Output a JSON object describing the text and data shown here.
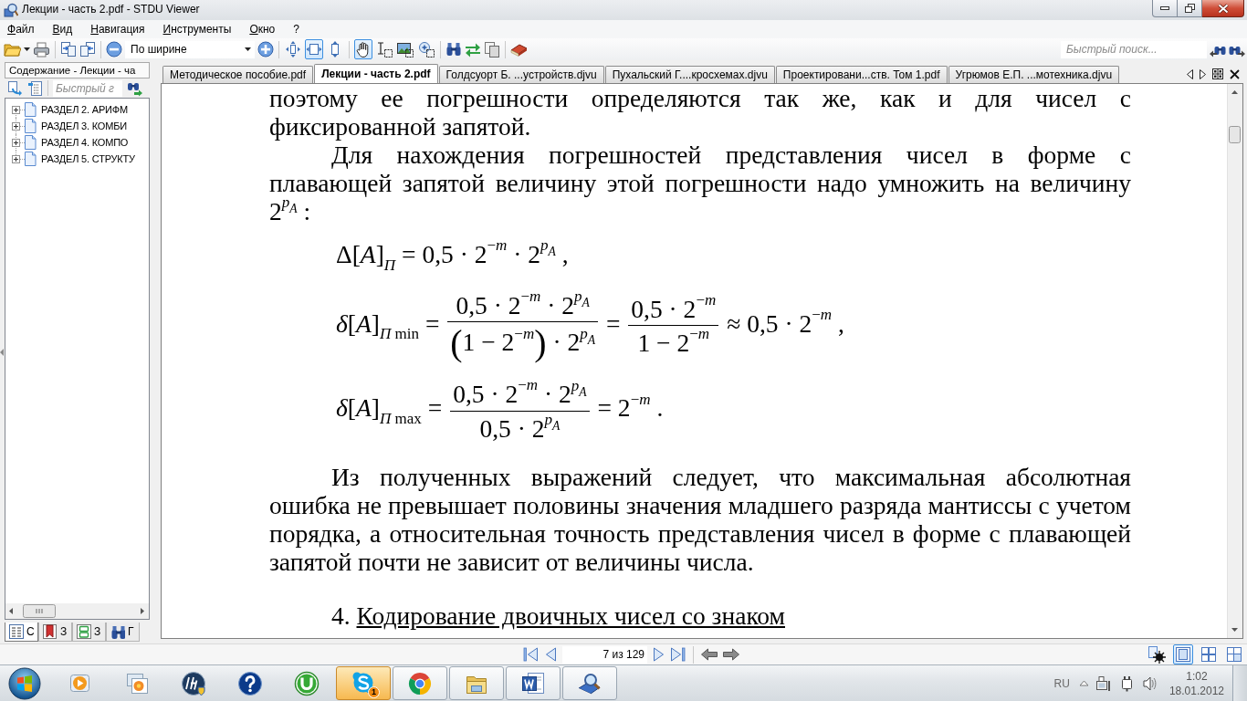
{
  "window": {
    "title": "Лекции - часть 2.pdf - STDU Viewer"
  },
  "menu": [
    "Файл",
    "Вид",
    "Навигация",
    "Инструменты",
    "Окно",
    "?"
  ],
  "toolbar": {
    "zoom_mode": "По ширине",
    "fit_buttons": [
      {
        "selected": false
      },
      {
        "selected": true
      },
      {
        "selected": false
      }
    ],
    "tool_buttons": [
      {
        "selected": true
      },
      {
        "selected": false
      },
      {
        "selected": false
      },
      {
        "selected": false
      }
    ],
    "quick_search": {
      "placeholder": "Быстрый поиск..."
    }
  },
  "sidebar": {
    "title": "Содержание - Лекции - ча",
    "search": {
      "placeholder": "Быстрый г"
    },
    "tree": [
      {
        "label": "РАЗДЕЛ 2. АРИФМ",
        "expanded": false
      },
      {
        "label": "РАЗДЕЛ 3. КОМБИ",
        "expanded": false
      },
      {
        "label": "РАЗДЕЛ 4. КОМПО",
        "expanded": false
      },
      {
        "label": "РАЗДЕЛ 5. СТРУКТУ",
        "expanded": false
      }
    ],
    "tabs": [
      {
        "label": "С",
        "selected": true
      },
      {
        "label": "З",
        "selected": false
      },
      {
        "label": "З",
        "selected": false
      },
      {
        "label": "Г",
        "selected": false
      }
    ]
  },
  "document_tabs": [
    {
      "label": "Методическое пособие.pdf",
      "selected": false
    },
    {
      "label": "Лекции - часть 2.pdf",
      "selected": true
    },
    {
      "label": "Голдсуорт Б. ...устройств.djvu",
      "selected": false
    },
    {
      "label": "Пухальский Г....кросхемах.djvu",
      "selected": false
    },
    {
      "label": "Проектировани...ств. Том 1.pdf",
      "selected": false
    },
    {
      "label": "Угрюмов Е.П. ...мотехника.djvu",
      "selected": false
    }
  ],
  "document": {
    "blocks": [
      {
        "kind": "paragraph",
        "indent": false,
        "text": "поэтому ее погрешности определяются так же, как и для чисел с фиксированной запятой."
      },
      {
        "kind": "paragraph",
        "indent": true,
        "text": "Для нахождения погрешностей представления чисел в форме с плавающей запятой величину этой погрешности надо умножить на величину",
        "math": [
          {
            "kind": "text",
            "text": "2"
          },
          {
            "kind": "sup",
            "text": "*p*",
            "sub": "*A*"
          },
          {
            "kind": "text",
            "text": " :"
          }
        ]
      },
      {
        "kind": "formula",
        "parts": [
          {
            "kind": "text",
            "text": "Δ[*A*]"
          },
          {
            "kind": "sub",
            "text": "*П*"
          },
          {
            "kind": "text",
            "text": " = 0,5 · 2"
          },
          {
            "kind": "sup",
            "text": "−*m*"
          },
          {
            "kind": "text",
            "text": " · 2"
          },
          {
            "kind": "sup",
            "text": "*p*",
            "sub": "*A*"
          },
          {
            "kind": "text",
            "text": " ,"
          }
        ]
      },
      {
        "kind": "formula",
        "parts": [
          {
            "kind": "text",
            "text": "*δ*[*A*]"
          },
          {
            "kind": "sub",
            "text": "*П* min"
          },
          {
            "kind": "text",
            "text": " = "
          },
          {
            "kind": "frac",
            "num": [
              {
                "kind": "text",
                "text": "0,5 · 2"
              },
              {
                "kind": "sup",
                "text": "−*m*"
              },
              {
                "kind": "text",
                "text": " · 2"
              },
              {
                "kind": "sup",
                "text": "*p*",
                "sub": "*A*"
              }
            ],
            "den": [
              {
                "kind": "big",
                "text": "("
              },
              {
                "kind": "text",
                "text": "1 − 2"
              },
              {
                "kind": "sup",
                "text": "−*m*"
              },
              {
                "kind": "big",
                "text": ")"
              },
              {
                "kind": "text",
                "text": " · 2"
              },
              {
                "kind": "sup",
                "text": "*p*",
                "sub": "*A*"
              }
            ]
          },
          {
            "kind": "text",
            "text": " = "
          },
          {
            "kind": "frac",
            "num": [
              {
                "kind": "text",
                "text": "0,5 · 2"
              },
              {
                "kind": "sup",
                "text": "−*m*"
              }
            ],
            "den": [
              {
                "kind": "text",
                "text": "1 − 2"
              },
              {
                "kind": "sup",
                "text": "−*m*"
              }
            ]
          },
          {
            "kind": "text",
            "text": " ≈ 0,5 · 2"
          },
          {
            "kind": "sup",
            "text": "−*m*"
          },
          {
            "kind": "text",
            "text": " ,"
          }
        ]
      },
      {
        "kind": "formula",
        "parts": [
          {
            "kind": "text",
            "text": "*δ*[*A*]"
          },
          {
            "kind": "sub",
            "text": "*П* max"
          },
          {
            "kind": "text",
            "text": " = "
          },
          {
            "kind": "frac",
            "num": [
              {
                "kind": "text",
                "text": "0,5 · 2"
              },
              {
                "kind": "sup",
                "text": "−*m*"
              },
              {
                "kind": "text",
                "text": " · 2"
              },
              {
                "kind": "sup",
                "text": "*p*",
                "sub": "*A*"
              }
            ],
            "den": [
              {
                "kind": "text",
                "text": "0,5 · 2"
              },
              {
                "kind": "sup",
                "text": "*p*",
                "sub": "*A*"
              }
            ]
          },
          {
            "kind": "text",
            "text": " = 2"
          },
          {
            "kind": "sup",
            "text": "−*m*"
          },
          {
            "kind": "text",
            "text": " ."
          }
        ]
      },
      {
        "kind": "paragraph",
        "indent": true,
        "text": "Из полученных выражений следует, что максимальная абсолютная ошибка не превышает половины значения младшего разряда мантиссы с учетом порядка, а относительная точность представления чисел в форме с плавающей запятой почти не зависит от величины числа."
      },
      {
        "kind": "heading",
        "number": "4.",
        "title": "Кодирование двоичных чисел со знаком"
      }
    ]
  },
  "navigation": {
    "page": "7 из 129",
    "view_modes": [
      {
        "selected": true
      },
      {
        "selected": false
      },
      {
        "selected": false
      }
    ]
  },
  "taskbar": {
    "apps": [
      {
        "running": false,
        "flashing": false
      },
      {
        "running": false,
        "flashing": false
      },
      {
        "running": false,
        "flashing": false
      },
      {
        "running": false,
        "flashing": false
      },
      {
        "running": false,
        "flashing": false
      },
      {
        "running": true,
        "flashing": true,
        "badge": "1"
      },
      {
        "running": true,
        "flashing": false
      },
      {
        "running": true,
        "flashing": false
      },
      {
        "running": true,
        "flashing": false
      },
      {
        "running": true,
        "flashing": false
      }
    ]
  },
  "tray": {
    "language": "RU",
    "time": "1:02",
    "date": "18.01.2012"
  }
}
